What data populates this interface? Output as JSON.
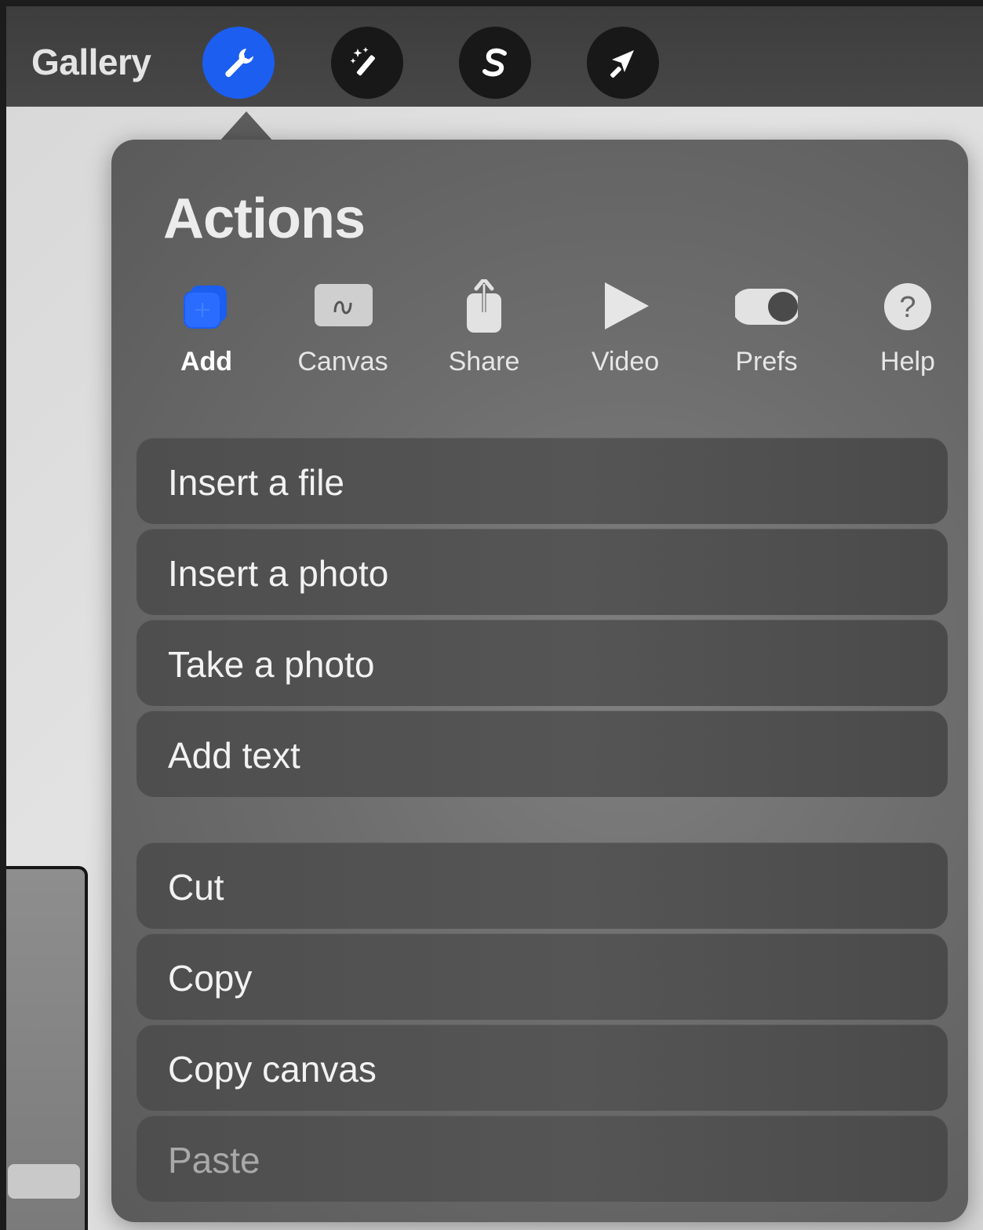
{
  "topbar": {
    "gallery_label": "Gallery",
    "tools": [
      {
        "name": "actions",
        "icon": "wrench-icon",
        "active": true
      },
      {
        "name": "adjustments",
        "icon": "magic-wand-icon",
        "active": false
      },
      {
        "name": "selection",
        "icon": "selection-s-icon",
        "active": false
      },
      {
        "name": "transform",
        "icon": "arrow-cursor-icon",
        "active": false
      }
    ],
    "accent_color": "#1b5ef0"
  },
  "popover": {
    "title": "Actions",
    "tabs": [
      {
        "label": "Add",
        "icon": "add-layers-icon",
        "active": true
      },
      {
        "label": "Canvas",
        "icon": "canvas-icon",
        "active": false
      },
      {
        "label": "Share",
        "icon": "share-icon",
        "active": false
      },
      {
        "label": "Video",
        "icon": "play-icon",
        "active": false
      },
      {
        "label": "Prefs",
        "icon": "toggle-icon",
        "active": false
      },
      {
        "label": "Help",
        "icon": "help-icon",
        "active": false
      }
    ],
    "group1": [
      {
        "label": "Insert a file"
      },
      {
        "label": "Insert a photo"
      },
      {
        "label": "Take a photo"
      },
      {
        "label": "Add text"
      }
    ],
    "group2": [
      {
        "label": "Cut",
        "enabled": true
      },
      {
        "label": "Copy",
        "enabled": true
      },
      {
        "label": "Copy canvas",
        "enabled": true
      },
      {
        "label": "Paste",
        "enabled": false
      }
    ]
  }
}
